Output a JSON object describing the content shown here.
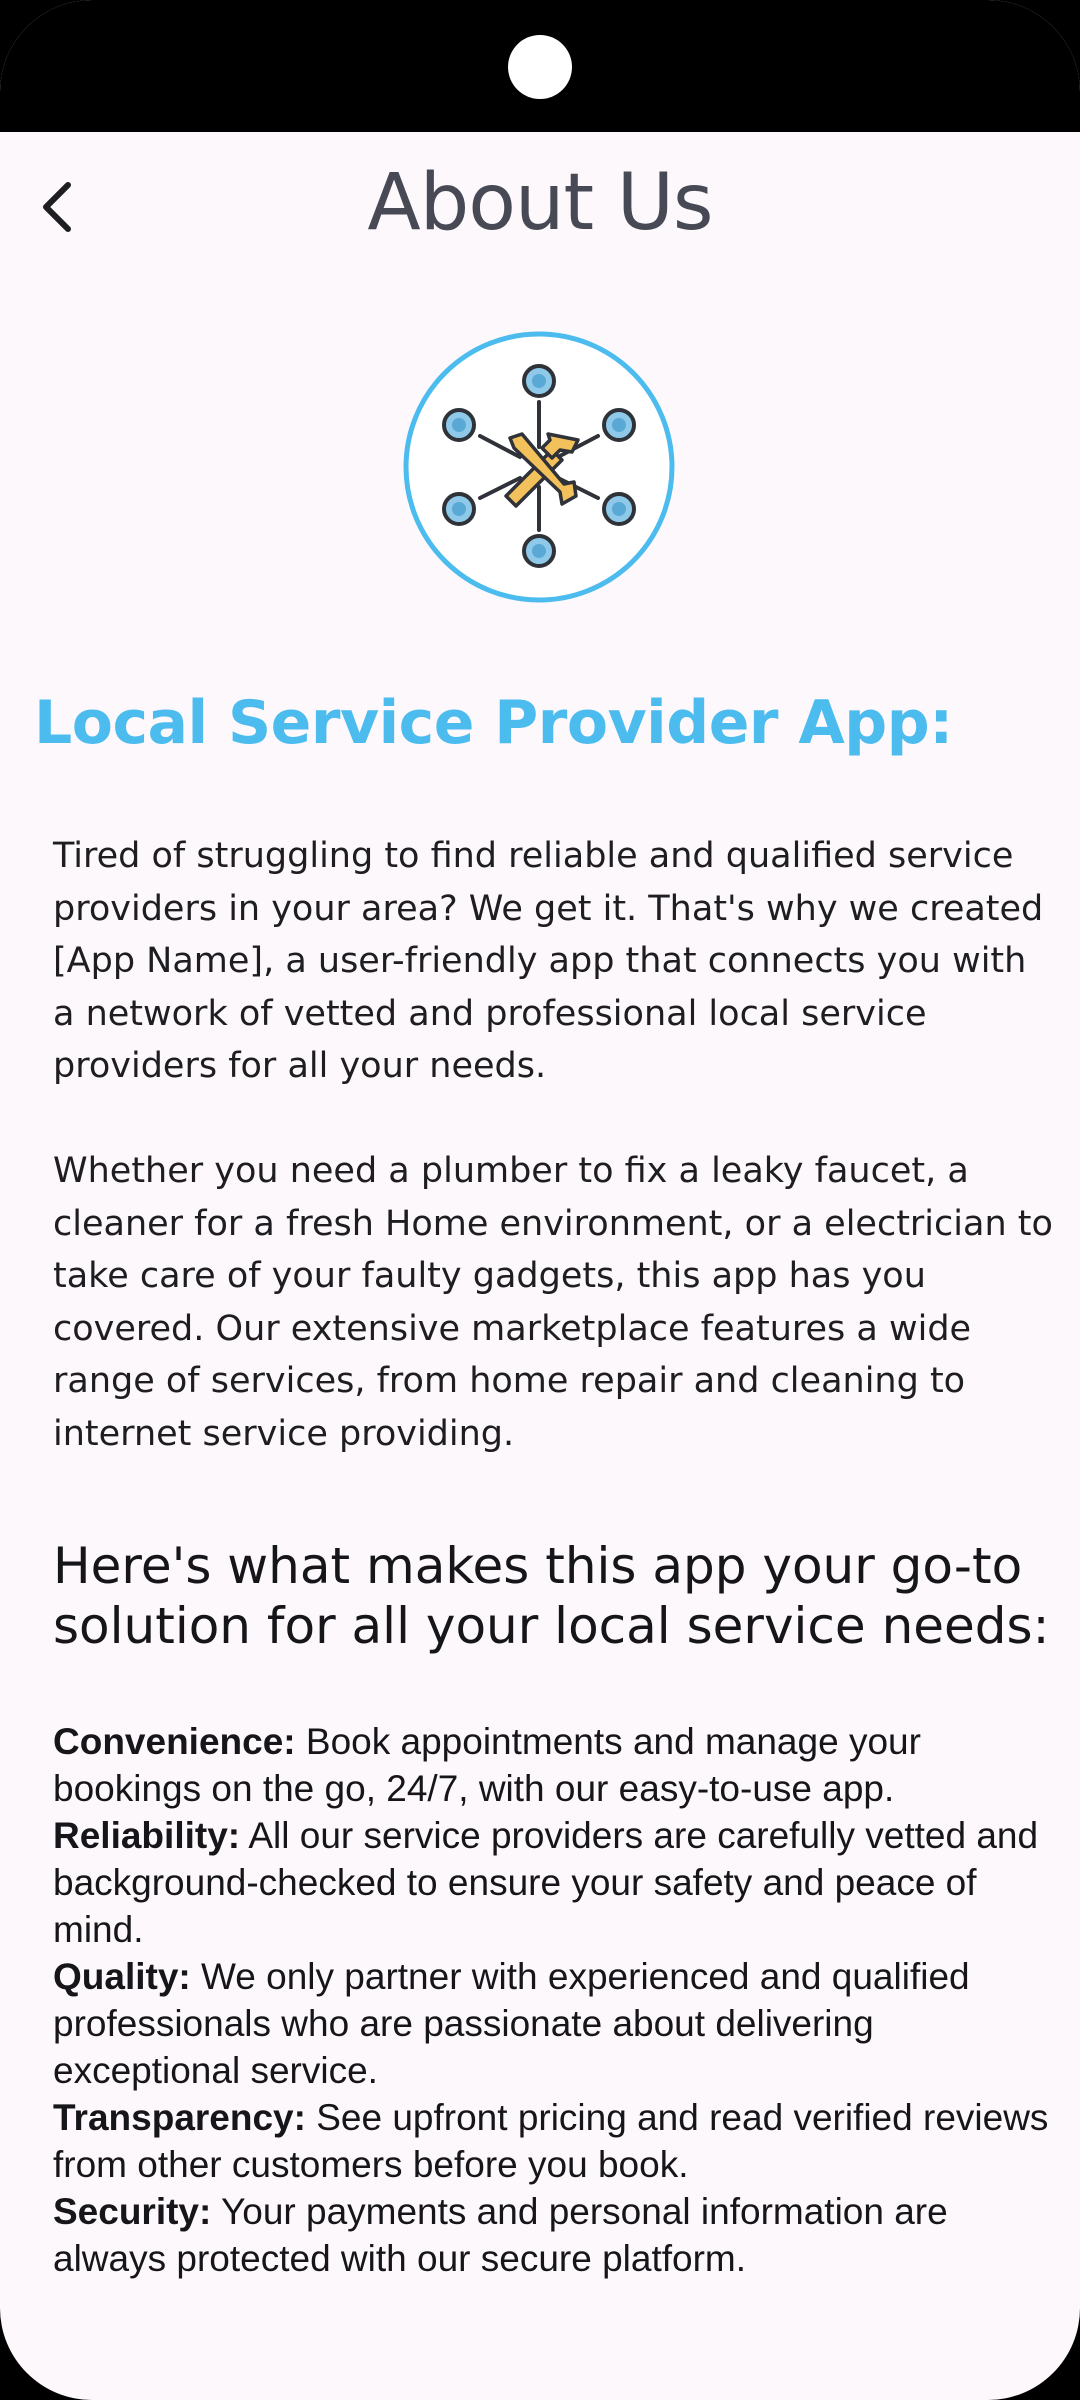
{
  "header": {
    "title": "About Us",
    "back_icon": "chevron-left-icon"
  },
  "logo": {
    "icon": "tools-network-icon",
    "ring_color": "#4cbcee",
    "node_color": "#8fc9ea",
    "tool_color": "#f3c15c"
  },
  "content": {
    "heading": "Local Service Provider App:",
    "heading_color": "#4cbcee",
    "paragraphs": [
      "Tired of struggling to find reliable and qualified service providers in your area? We get it. That's why we created [App Name], a user-friendly app that connects you with a network of vetted and professional local service providers for all your needs.",
      "Whether you need a plumber to fix a leaky faucet, a cleaner for a fresh Home environment, or a electrician to take care of your faulty gadgets, this app has you covered. Our extensive marketplace features a wide range of services, from home repair and cleaning to internet service providing."
    ],
    "subheading": "Here's what makes this app your go-to solution for all your local service needs:",
    "features": [
      {
        "title": "Convenience:",
        "text": " Book appointments and manage your bookings on the go, 24/7, with our easy-to-use app."
      },
      {
        "title": "Reliability:",
        "text": " All our service providers are carefully vetted and background-checked to ensure your safety and peace of mind."
      },
      {
        "title": "Quality:",
        "text": " We only partner with experienced and qualified professionals who are passionate about delivering exceptional service."
      },
      {
        "title": "Transparency:",
        "text": " See upfront pricing and read verified reviews from other customers before you book."
      },
      {
        "title": "Security:",
        "text": " Your payments and personal information are always protected with our secure platform."
      }
    ]
  }
}
